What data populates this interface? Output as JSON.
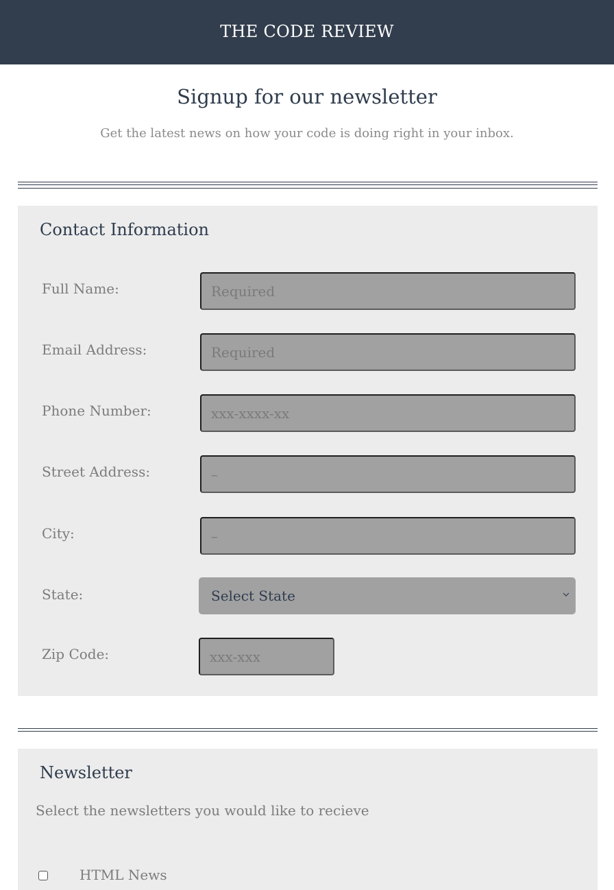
{
  "header": {
    "brand": "THE CODE REVIEW"
  },
  "hero": {
    "title": "Signup for our newsletter",
    "subtitle": "Get the latest news on how your code is doing right in your inbox."
  },
  "contact": {
    "title": "Contact Information",
    "fields": [
      {
        "label": "Full Name:",
        "placeholder": "Required",
        "value": ""
      },
      {
        "label": "Email Address:",
        "placeholder": "Required",
        "value": ""
      },
      {
        "label": "Phone Number:",
        "placeholder": "xxx-xxxx-xx",
        "value": ""
      },
      {
        "label": "Street Address:",
        "placeholder": "–",
        "value": ""
      },
      {
        "label": "City:",
        "placeholder": "–",
        "value": ""
      }
    ],
    "state": {
      "label": "State:",
      "selected": "Select State",
      "icon": "chevron-down-icon"
    },
    "zip": {
      "label": "Zip Code:",
      "placeholder": "xxx-xxx",
      "value": ""
    }
  },
  "newsletter": {
    "title": "Newsletter",
    "subtitle": "Select the newsletters you would like to recieve",
    "options": [
      {
        "label": "HTML News",
        "checked": false
      }
    ]
  },
  "colors": {
    "topbar": "#323e4d",
    "panel": "#ececec",
    "input_bg": "#a1a1a2",
    "heading": "#2f3c4c",
    "muted_text": "#7c7c7c"
  }
}
